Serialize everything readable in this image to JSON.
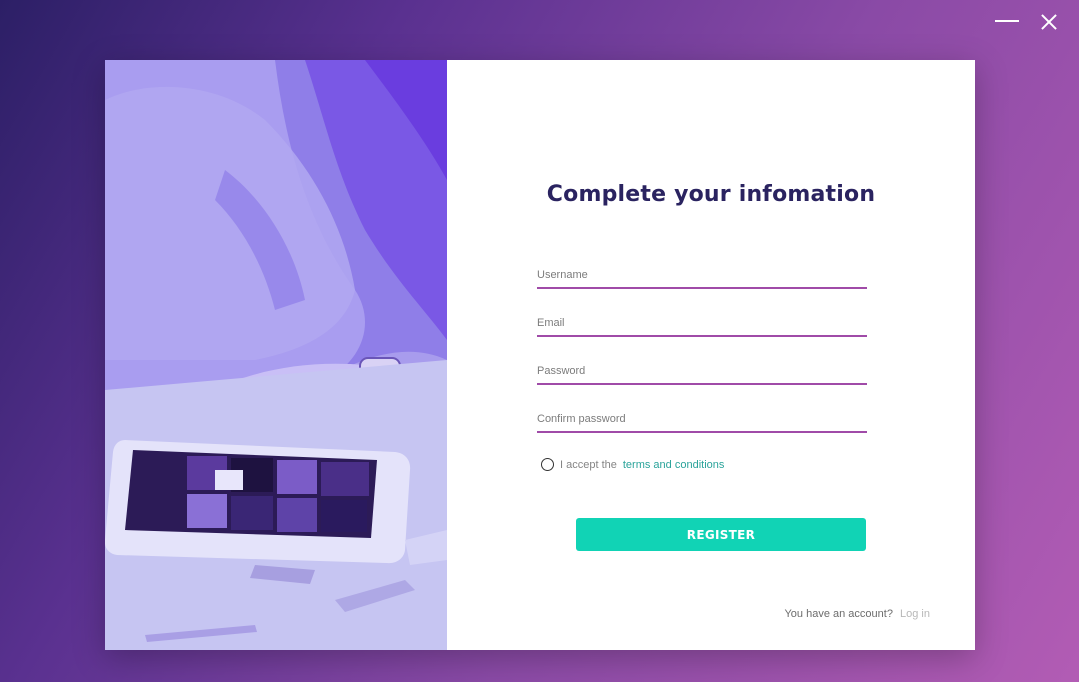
{
  "window": {
    "controls": [
      "minimize-icon",
      "close-icon"
    ]
  },
  "form": {
    "title": "Complete your infomation",
    "fields": {
      "username": {
        "placeholder": "Username",
        "value": ""
      },
      "email": {
        "placeholder": "Email",
        "value": ""
      },
      "password": {
        "placeholder": "Password",
        "value": ""
      },
      "confirm_password": {
        "placeholder": "Confirm password",
        "value": ""
      }
    },
    "terms": {
      "prefix": "I accept the",
      "link": "terms and conditions"
    },
    "register_label": "REGISTER",
    "account_prompt": "You have an account?",
    "login_label": "Log in"
  },
  "colors": {
    "accent": "#11d3b5",
    "underline": "#a04ba8",
    "title": "#2a2360",
    "link": "#2aa39a"
  }
}
